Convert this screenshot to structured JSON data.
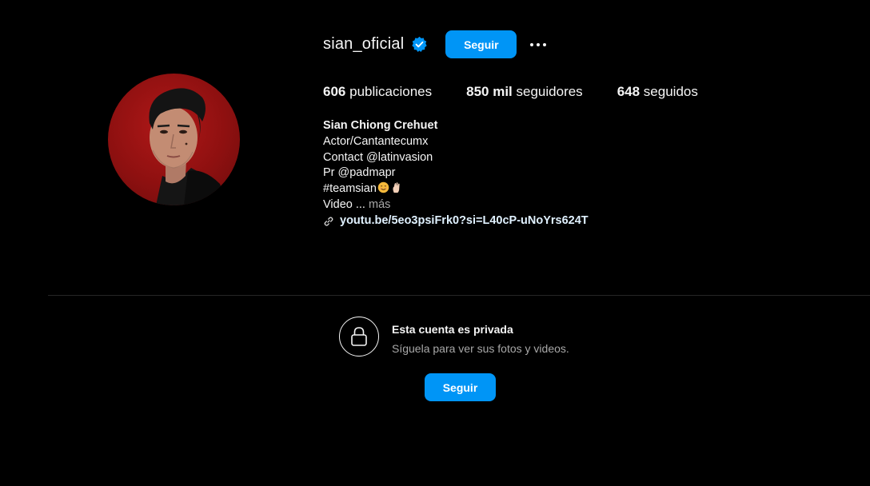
{
  "profile": {
    "username": "sian_oficial",
    "verified_icon": "verified-badge-icon",
    "follow_label": "Seguir",
    "more_icon": "more-options-icon",
    "avatar_icon": "profile-avatar"
  },
  "stats": {
    "posts_count": "606",
    "posts_label": "publicaciones",
    "followers_count": "850 mil",
    "followers_label": "seguidores",
    "following_count": "648",
    "following_label": "seguidos"
  },
  "bio": {
    "name": "Sian Chiong Crehuet",
    "line1": "Actor/Cantantecumx",
    "line2": "Contact @latinvasion",
    "line3": "Pr @padmapr",
    "line4": "#teamsian",
    "line5_text": "Video ...",
    "line5_more": "más",
    "link_icon": "link-icon",
    "link": "youtu.be/5eo3psiFrk0?si=L40cP-uNoYrs624T"
  },
  "private": {
    "lock_icon": "lock-icon",
    "title": "Esta cuenta es privada",
    "subtitle": "Síguela para ver sus fotos y videos.",
    "follow_label": "Seguir"
  },
  "colors": {
    "accent": "#0095f6",
    "background": "#000000",
    "avatar_bg": "#b01818"
  }
}
